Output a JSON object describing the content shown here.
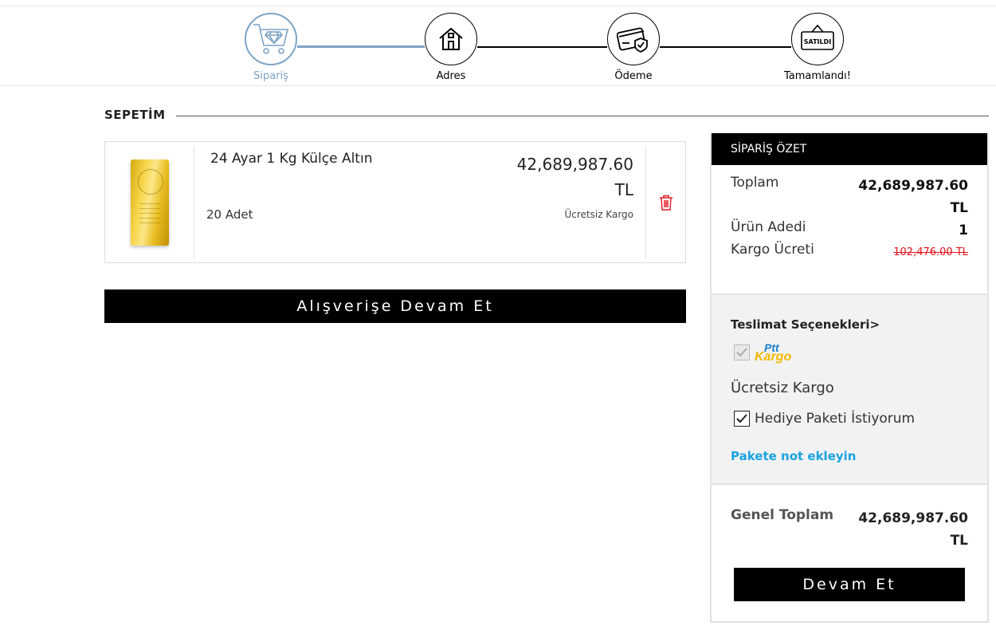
{
  "steps": [
    {
      "label": "Sipariş",
      "icon": "cart-diamond-icon",
      "active": true
    },
    {
      "label": "Adres",
      "icon": "house-icon"
    },
    {
      "label": "Ödeme",
      "icon": "credit-card-shield-icon"
    },
    {
      "label": "Tamamlandı!",
      "icon": "sold-sign-icon",
      "sign_text": "SATILDI"
    }
  ],
  "cart": {
    "title": "SEPETİM",
    "item": {
      "name": "24 Ayar 1 Kg Külçe Altın",
      "quantity": "20 Adet",
      "price": "42,689,987.60",
      "currency": "TL",
      "shipping": "Ücretsiz Kargo"
    },
    "continue_label": "Alışverişe Devam Et"
  },
  "summary": {
    "header": "SİPARİŞ ÖZET",
    "total_label": "Toplam",
    "total_value": "42,689,987.60",
    "total_currency": "TL",
    "count_label": "Ürün Adedi",
    "count_value": "1",
    "shipping_fee_label": "Kargo Ücreti",
    "shipping_fee_value": "102,476.00 TL",
    "delivery_title": "Teslimat Seçenekleri>",
    "carrier_logo_top": "Ptt",
    "carrier_logo_bottom": "Kargo",
    "free_shipping": "Ücretsiz Kargo",
    "gift_label": "Hediye Paketi İstiyorum",
    "note_link": "Pakete not ekleyin",
    "grand_total_label": "Genel Toplam",
    "grand_total_value": "42,689,987.60",
    "grand_total_currency": "TL",
    "continue_label": "Devam Et"
  },
  "colors": {
    "accent": "#7ea3c4",
    "link": "#1aa3e0",
    "strike": "#e0141e",
    "gold": "#f2c94c"
  }
}
